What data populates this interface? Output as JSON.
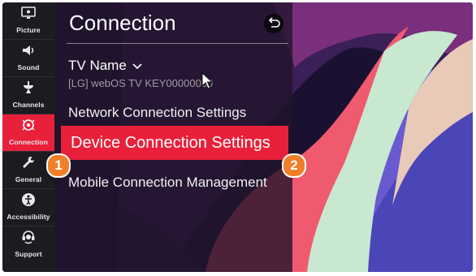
{
  "sidebar": {
    "items": [
      {
        "label": "Picture",
        "icon": "picture-icon",
        "active": false
      },
      {
        "label": "Sound",
        "icon": "speaker-icon",
        "active": false
      },
      {
        "label": "Channels",
        "icon": "satellite-dish-icon",
        "active": false
      },
      {
        "label": "Connection",
        "icon": "connection-icon",
        "active": true
      },
      {
        "label": "General",
        "icon": "wrench-icon",
        "active": false
      },
      {
        "label": "Accessibility",
        "icon": "accessibility-icon",
        "active": false
      },
      {
        "label": "Support",
        "icon": "headset-icon",
        "active": false
      }
    ]
  },
  "panel": {
    "title": "Connection",
    "back_icon": "back-arrow-icon",
    "tv_name_label": "TV Name",
    "tv_name_value": "[LG] webOS TV KEY00000030",
    "menu": [
      {
        "label": "Network Connection Settings",
        "selected": false
      },
      {
        "label": "Device Connection Settings",
        "selected": true
      },
      {
        "label": "Mobile Connection Management",
        "selected": false
      }
    ]
  },
  "callouts": {
    "step1": "1",
    "step2": "2"
  },
  "colors": {
    "accent_red": "#e8203a",
    "callout_orange": "#f07f28",
    "sidebar_bg": "#1c1c20"
  }
}
